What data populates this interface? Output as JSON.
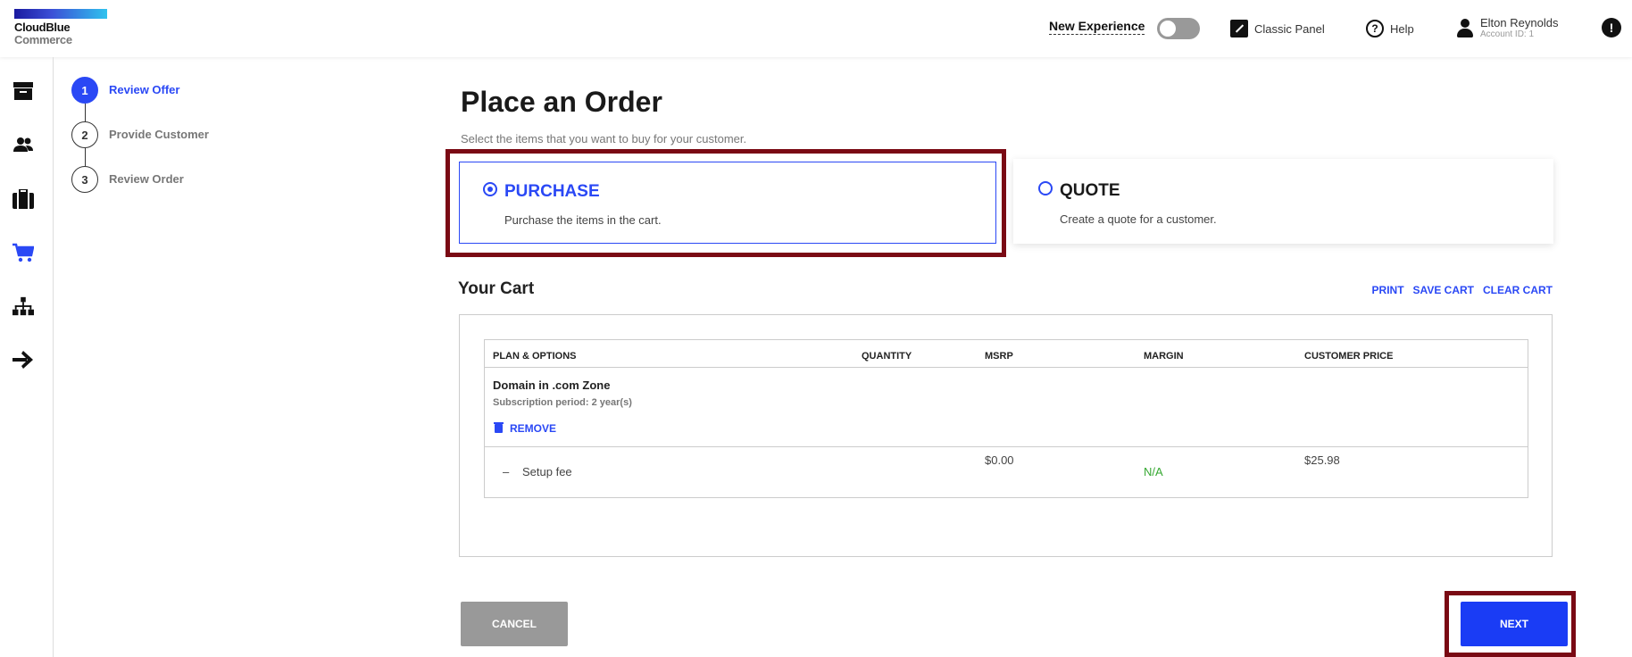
{
  "brand": {
    "line1": "CloudBlue",
    "line2": "Commerce"
  },
  "header": {
    "new_experience": "New Experience",
    "classic_panel": "Classic Panel",
    "help": "Help",
    "user_name": "Elton Reynolds",
    "account_id": "Account ID: 1"
  },
  "leftnav": {
    "items": [
      "archive-icon",
      "users-icon",
      "briefcase-icon",
      "cart-icon",
      "org-chart-icon",
      "arrow-right-icon"
    ]
  },
  "stepper": {
    "steps": [
      {
        "num": "1",
        "label": "Review Offer"
      },
      {
        "num": "2",
        "label": "Provide Customer"
      },
      {
        "num": "3",
        "label": "Review Order"
      }
    ]
  },
  "page": {
    "title": "Place an Order",
    "subtitle": "Select the items that you want to buy for your customer."
  },
  "options": {
    "purchase": {
      "title": "PURCHASE",
      "desc": "Purchase the items in the cart."
    },
    "quote": {
      "title": "QUOTE",
      "desc": "Create a quote for a customer."
    }
  },
  "cart": {
    "title": "Your Cart",
    "links": {
      "print": "PRINT",
      "save": "SAVE CART",
      "clear": "CLEAR CART"
    },
    "columns": {
      "plan": "PLAN & OPTIONS",
      "quantity": "QUANTITY",
      "msrp": "MSRP",
      "margin": "MARGIN",
      "customer_price": "CUSTOMER PRICE"
    },
    "item": {
      "name": "Domain in .com Zone",
      "subscription": "Subscription period: 2 year(s)",
      "remove": "REMOVE"
    },
    "fee": {
      "dash": "–",
      "label": "Setup fee",
      "msrp": "$0.00",
      "margin": "N/A",
      "customer_price": "$25.98"
    }
  },
  "buttons": {
    "cancel": "CANCEL",
    "next": "NEXT"
  },
  "colors": {
    "accent": "#2a48f5",
    "highlight": "#7a0a14",
    "margin_na": "#36a832"
  }
}
